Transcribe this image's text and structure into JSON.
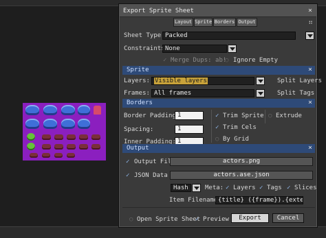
{
  "dialog": {
    "title": "Export Sprite Sheet",
    "close": "×",
    "tabs": [
      "Layout",
      "Sprite",
      "Borders",
      "Output"
    ],
    "pin_icon": "⠶"
  },
  "layout": {
    "sheet_type_label": "Sheet Type:",
    "sheet_type_value": "Packed",
    "constraints_label": "Constraints:",
    "constraints_value": "None",
    "merge_dups_label": "Merge Dups: ab!",
    "ignore_empty_label": "Ignore Empty"
  },
  "sprite": {
    "title": "Sprite",
    "layers_label": "Layers:",
    "layers_value": "Visible layers",
    "split_layers_label": "Split Layers",
    "frames_label": "Frames:",
    "frames_value": "All frames",
    "split_tags_label": "Split Tags"
  },
  "borders": {
    "title": "Borders",
    "border_padding_label": "Border Padding:",
    "border_padding_value": "1",
    "spacing_label": "Spacing:",
    "spacing_value": "1",
    "inner_padding_label": "Inner Padding:",
    "inner_padding_value": "1",
    "trim_sprite_label": "Trim Sprite",
    "trim_cels_label": "Trim Cels",
    "by_grid_label": "By Grid",
    "extrude_label": "Extrude"
  },
  "output": {
    "title": "Output",
    "output_file_label": "Output File",
    "output_file_value": "actors.png",
    "json_data_label": "JSON Data",
    "json_data_value": "actors.ase.json",
    "format_value": "Hash",
    "meta_label": "Meta:",
    "meta_layers_label": "Layers",
    "meta_tags_label": "Tags",
    "meta_slices_label": "Slices",
    "item_filename_label": "Item Filename:",
    "item_filename_value": "{title} ({frame}).{extension}"
  },
  "footer": {
    "open_sprite_sheet_label": "Open Sprite Sheet",
    "preview_label": "Preview",
    "export_label": "Export",
    "cancel_label": "Cancel"
  },
  "glyphs": {
    "check": "✓",
    "empty": "○"
  },
  "colors": {
    "section_header": "#2e4a78",
    "preview_bg": "#8b1fbf"
  }
}
